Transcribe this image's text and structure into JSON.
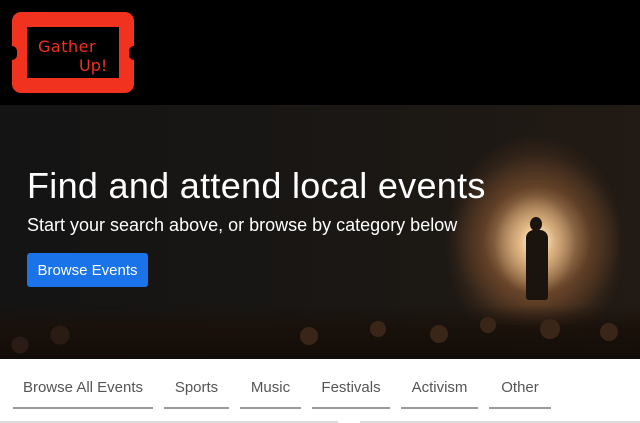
{
  "logo": {
    "line1": "Gather",
    "line2": "Up!"
  },
  "hero": {
    "title": "Find and attend local events",
    "subtitle": "Start your search above, or browse by category below",
    "button": "Browse Events"
  },
  "categories": [
    "Browse All Events",
    "Sports",
    "Music",
    "Festivals",
    "Activism",
    "Other"
  ],
  "colors": {
    "brand_red": "#f0321e",
    "button_blue": "#1a73e8",
    "topbar": "#000000"
  }
}
